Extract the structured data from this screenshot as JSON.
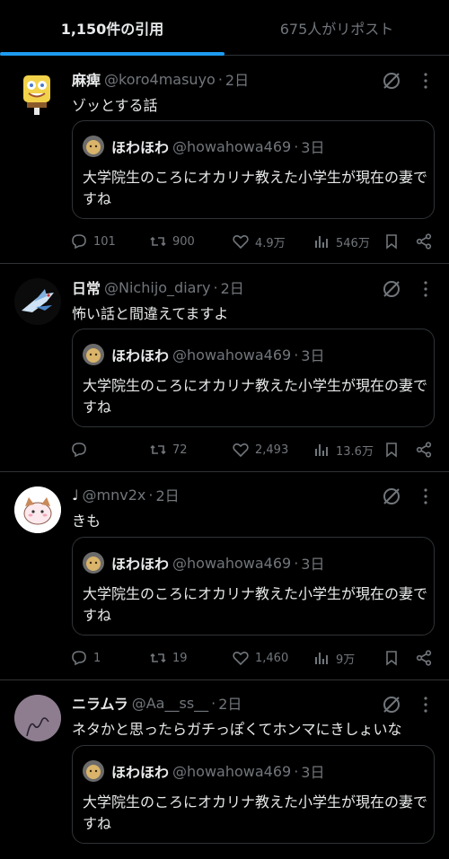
{
  "tabs": [
    {
      "label": "1,150件の引用"
    },
    {
      "label": "675人がリポスト"
    }
  ],
  "posts": [
    {
      "name": "麻痺",
      "handle": "@koro4masuyo",
      "time": "2日",
      "text": "ゾッとする話",
      "quote": {
        "name": "ほわほわ",
        "handle": "@howahowa469",
        "time": "3日",
        "text": "大学院生のころにオカリナ教えた小学生が現在の妻ですね"
      },
      "stats": {
        "replies": "101",
        "reposts": "900",
        "likes": "4.9万",
        "views": "546万"
      }
    },
    {
      "name": "日常",
      "handle": "@Nichijo_diary",
      "time": "2日",
      "text": "怖い話と間違えてますよ",
      "quote": {
        "name": "ほわほわ",
        "handle": "@howahowa469",
        "time": "3日",
        "text": "大学院生のころにオカリナ教えた小学生が現在の妻ですね"
      },
      "stats": {
        "replies": "",
        "reposts": "72",
        "likes": "2,493",
        "views": "13.6万"
      }
    },
    {
      "name": "♩",
      "handle": "@mnv2x",
      "time": "2日",
      "text": "きも",
      "quote": {
        "name": "ほわほわ",
        "handle": "@howahowa469",
        "time": "3日",
        "text": "大学院生のころにオカリナ教えた小学生が現在の妻ですね"
      },
      "stats": {
        "replies": "1",
        "reposts": "19",
        "likes": "1,460",
        "views": "9万"
      }
    },
    {
      "name": "ニラムラ",
      "handle": "@Aa__ss__",
      "time": "2日",
      "text": "ネタかと思ったらガチっぽくてホンマにきしょいな",
      "quote": {
        "name": "ほわほわ",
        "handle": "@howahowa469",
        "time": "3日",
        "text": "大学院生のころにオカリナ教えた小学生が現在の妻ですね"
      },
      "stats": {
        "replies": "",
        "reposts": "",
        "likes": "",
        "views": ""
      }
    }
  ],
  "colors": {
    "accent": "#1d9bf0",
    "text": "#e7e9ea",
    "muted": "#71767b",
    "border": "#2f3336",
    "background": "#000000"
  }
}
